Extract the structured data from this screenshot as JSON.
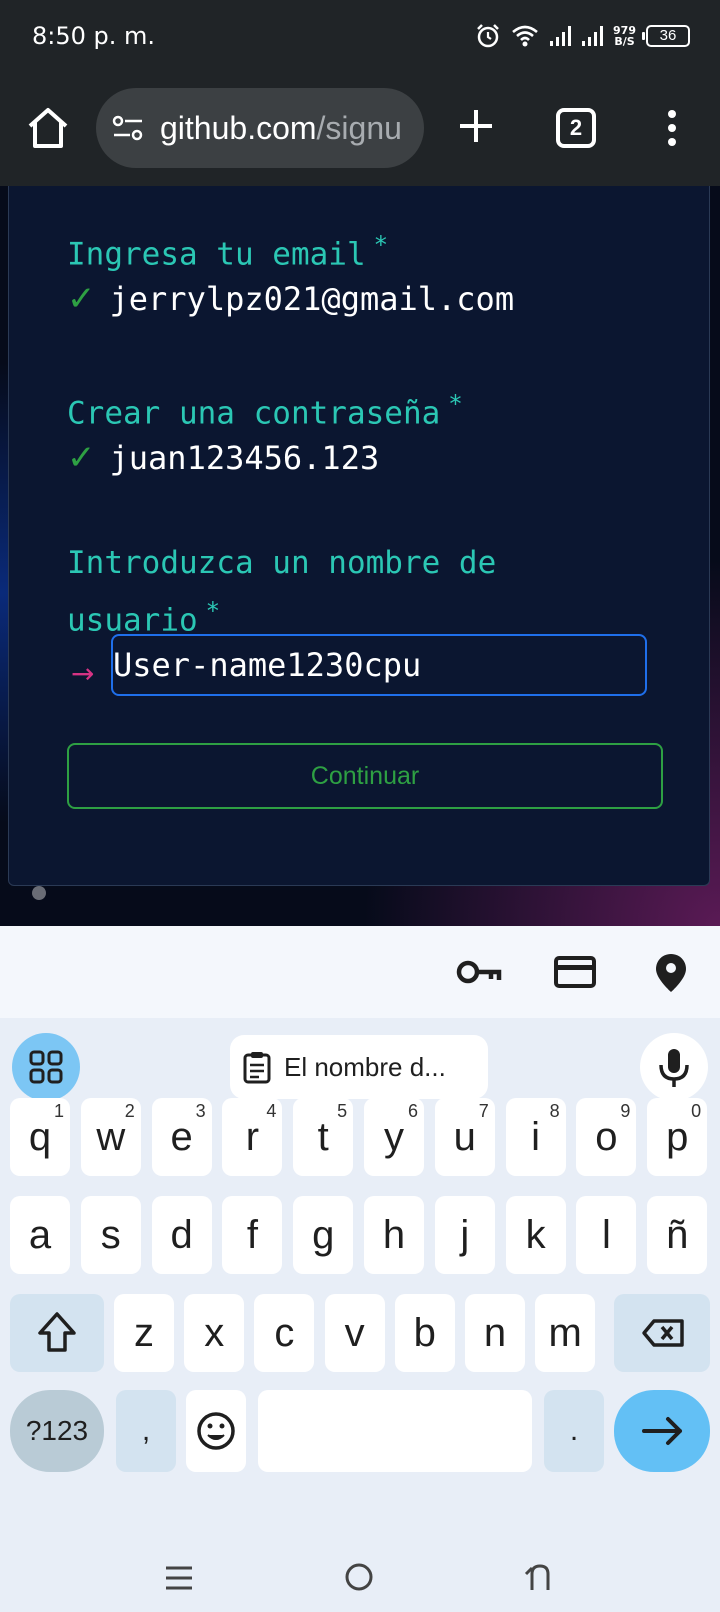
{
  "status_bar": {
    "time": "8:50 p. m.",
    "net_speed_value": "979",
    "net_speed_unit": "B/S",
    "battery": "36"
  },
  "browser": {
    "url_host": "github.com",
    "url_rest": "/signu",
    "tab_count": "2"
  },
  "form": {
    "email_label": "Ingresa tu email",
    "email_value": "jerrylpz021@gmail.com",
    "password_label": "Crear una contraseña",
    "password_value": "juan123456.123",
    "username_label_line1": "Introduzca un nombre de",
    "username_label_line2": "usuario",
    "required_mark": "*",
    "check_mark": "✓",
    "arrow_mark": "→",
    "username_value": "User-name1230cpu",
    "continue_label": "Continuar"
  },
  "keyboard": {
    "clipboard_suggestion": "El nombre d...",
    "row1": [
      {
        "key": "q",
        "hint": "1"
      },
      {
        "key": "w",
        "hint": "2"
      },
      {
        "key": "e",
        "hint": "3"
      },
      {
        "key": "r",
        "hint": "4"
      },
      {
        "key": "t",
        "hint": "5"
      },
      {
        "key": "y",
        "hint": "6"
      },
      {
        "key": "u",
        "hint": "7"
      },
      {
        "key": "i",
        "hint": "8"
      },
      {
        "key": "o",
        "hint": "9"
      },
      {
        "key": "p",
        "hint": "0"
      }
    ],
    "row2": [
      "a",
      "s",
      "d",
      "f",
      "g",
      "h",
      "j",
      "k",
      "l",
      "ñ"
    ],
    "row3": [
      "z",
      "x",
      "c",
      "v",
      "b",
      "n",
      "m"
    ],
    "symbols_label": "?123",
    "comma_label": ",",
    "period_label": "."
  },
  "colors": {
    "label_teal": "#2bc7b4",
    "check_green": "#2ea043",
    "input_border_blue": "#1f6feb",
    "arrow_pink": "#d63384"
  }
}
